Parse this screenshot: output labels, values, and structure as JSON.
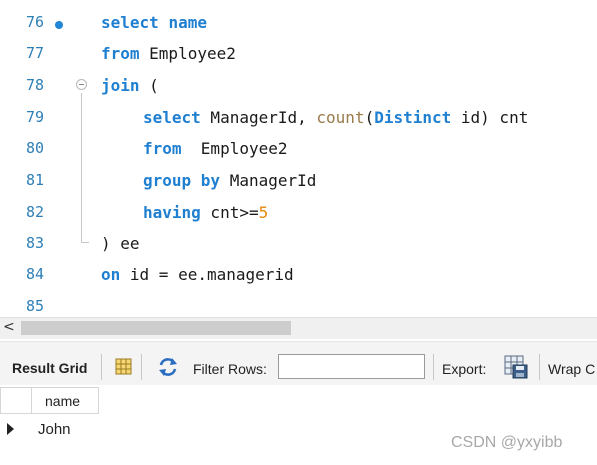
{
  "editor": {
    "lines": [
      {
        "num": "76",
        "parts": [
          "select",
          " ",
          "name"
        ]
      },
      {
        "num": "77",
        "parts": [
          "from",
          " Employee2"
        ]
      },
      {
        "num": "78",
        "parts": [
          "join",
          " ("
        ]
      },
      {
        "num": "79",
        "parts": [
          "select",
          " ManagerId, ",
          "count",
          "(",
          "Distinct",
          " id) cnt"
        ]
      },
      {
        "num": "80",
        "parts": [
          "from",
          "  Employee2"
        ]
      },
      {
        "num": "81",
        "parts": [
          "group by",
          " ManagerId"
        ]
      },
      {
        "num": "82",
        "parts": [
          "having",
          " cnt>=",
          "5"
        ]
      },
      {
        "num": "83",
        "parts": [
          ") ee"
        ]
      },
      {
        "num": "84",
        "parts": [
          "on",
          " id = ee.managerid"
        ]
      },
      {
        "num": "85",
        "parts": [
          ""
        ]
      }
    ]
  },
  "scrollbar": {
    "left_arrow": "<"
  },
  "toolbar": {
    "result_grid_label": "Result Grid",
    "filter_rows_label": "Filter Rows:",
    "filter_rows_value": "",
    "export_label": "Export:",
    "wrap_label": "Wrap C"
  },
  "grid": {
    "columns": [
      "name"
    ],
    "rows": [
      [
        "John"
      ]
    ]
  },
  "watermark": "CSDN @yxyibb",
  "colors": {
    "keyword": "#1f7fd0",
    "line_number": "#2e7fb8",
    "number": "#e3870c",
    "function": "#9a7a4a"
  }
}
